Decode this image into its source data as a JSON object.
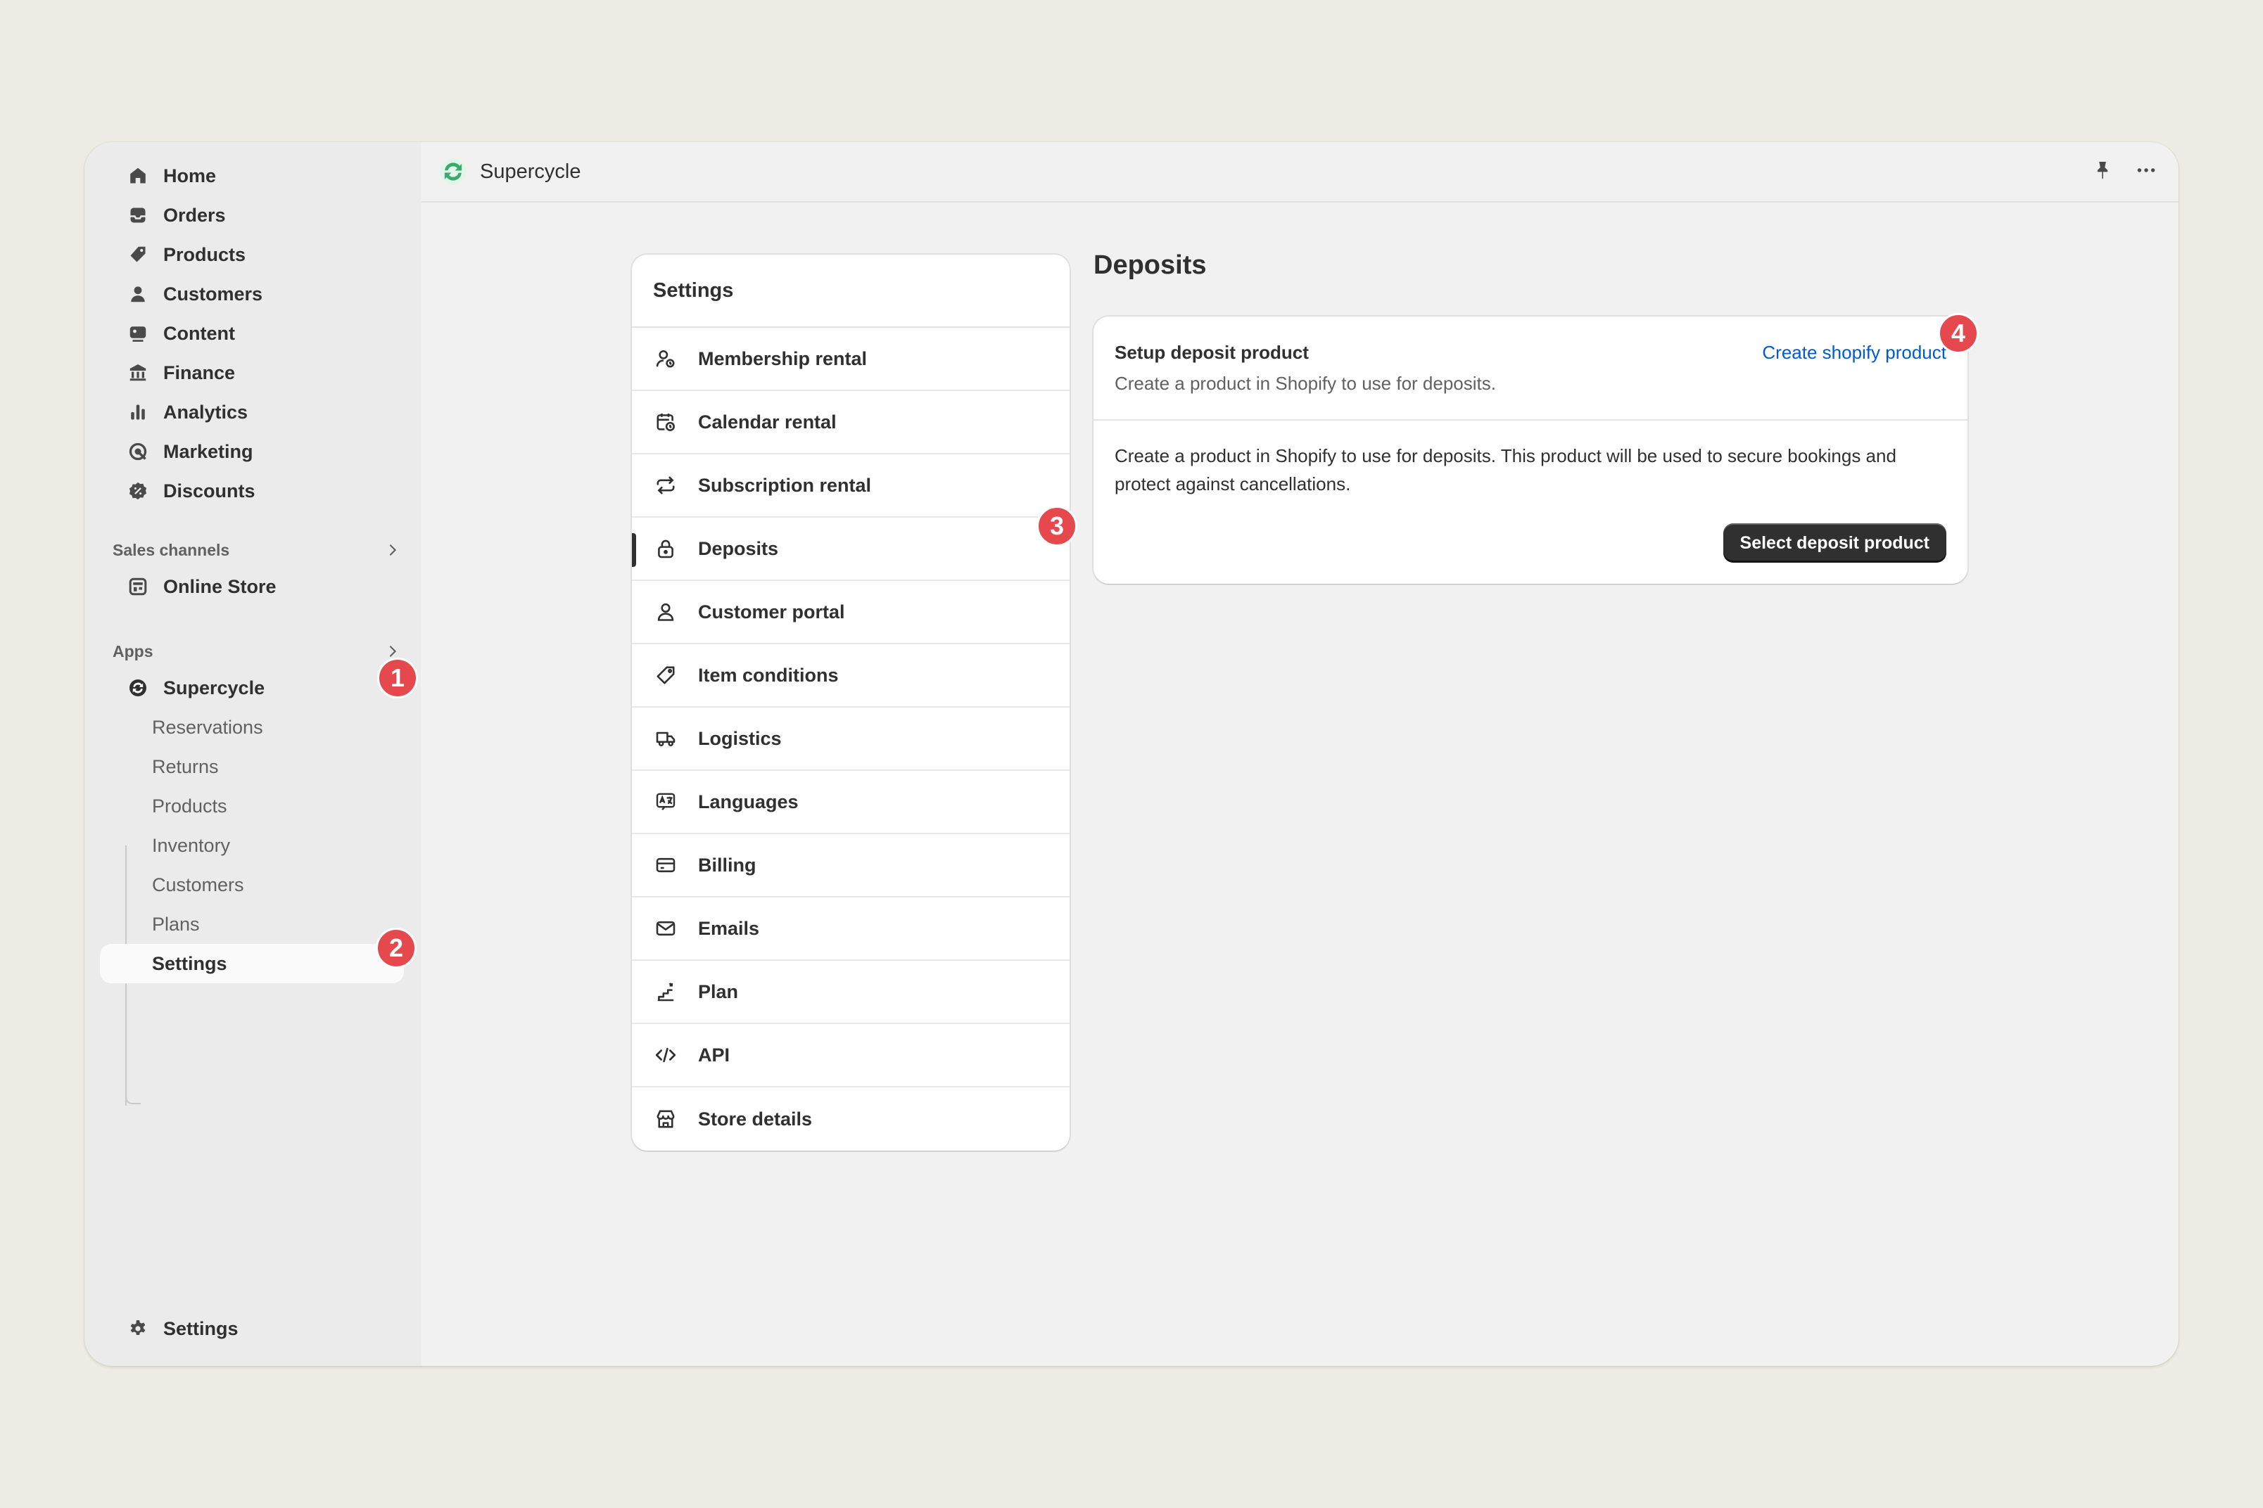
{
  "sidebar": {
    "main_nav": [
      {
        "label": "Home",
        "icon": "home-icon"
      },
      {
        "label": "Orders",
        "icon": "orders-icon"
      },
      {
        "label": "Products",
        "icon": "tag-icon"
      },
      {
        "label": "Customers",
        "icon": "person-icon"
      },
      {
        "label": "Content",
        "icon": "content-icon"
      },
      {
        "label": "Finance",
        "icon": "bank-icon"
      },
      {
        "label": "Analytics",
        "icon": "bar-chart-icon"
      },
      {
        "label": "Marketing",
        "icon": "target-icon"
      },
      {
        "label": "Discounts",
        "icon": "discount-icon"
      }
    ],
    "sales_channels": {
      "label": "Sales channels",
      "items": [
        {
          "label": "Online Store",
          "icon": "store-icon"
        }
      ]
    },
    "apps": {
      "label": "Apps",
      "app": {
        "label": "Supercycle",
        "icon": "supercycle-icon"
      },
      "sub_items": [
        "Reservations",
        "Returns",
        "Products",
        "Inventory",
        "Customers",
        "Plans",
        "Settings"
      ],
      "active_sub_item": "Settings"
    },
    "footer": {
      "label": "Settings",
      "icon": "gear-icon"
    }
  },
  "topbar": {
    "app_title": "Supercycle",
    "accent": "#3BAA6E"
  },
  "settings_menu": {
    "title": "Settings",
    "items": [
      {
        "label": "Membership rental",
        "icon": "membership-icon"
      },
      {
        "label": "Calendar rental",
        "icon": "calendar-clock-icon"
      },
      {
        "label": "Subscription rental",
        "icon": "repeat-icon"
      },
      {
        "label": "Deposits",
        "icon": "lock-icon",
        "active": true
      },
      {
        "label": "Customer portal",
        "icon": "person-icon"
      },
      {
        "label": "Item conditions",
        "icon": "tag-icon"
      },
      {
        "label": "Logistics",
        "icon": "truck-icon"
      },
      {
        "label": "Languages",
        "icon": "language-icon"
      },
      {
        "label": "Billing",
        "icon": "credit-card-icon"
      },
      {
        "label": "Emails",
        "icon": "email-icon"
      },
      {
        "label": "Plan",
        "icon": "plan-icon"
      },
      {
        "label": "API",
        "icon": "code-icon"
      },
      {
        "label": "Store details",
        "icon": "store-icon"
      }
    ]
  },
  "deposits": {
    "page_title": "Deposits",
    "card_title": "Setup deposit product",
    "card_subtitle": "Create a product in Shopify to use for deposits.",
    "link_label": "Create shopify product",
    "body_text": "Create a product in Shopify to use for deposits. This product will be used to secure bookings and protect against cancellations.",
    "button_label": "Select deposit product"
  },
  "callouts": [
    "1",
    "2",
    "3",
    "4"
  ],
  "colors": {
    "badge": "#E5484D",
    "link": "#005BD3",
    "primary_button": "#303030"
  }
}
